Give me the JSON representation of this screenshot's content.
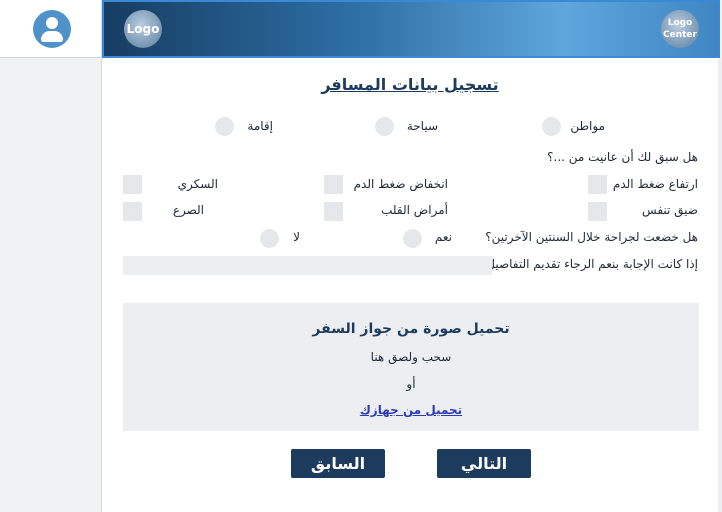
{
  "header": {
    "logo_left": "Logo",
    "logo_right_line1": "Logo",
    "logo_right_line2": "Center"
  },
  "sidebar": {
    "avatar_icon": "user-avatar-icon"
  },
  "form": {
    "title": "تسجيل بيانات المسافر",
    "traveler_type": {
      "options": [
        "مواطن",
        "سياحة",
        "إقامة"
      ]
    },
    "conditions": {
      "question": "هل سبق لك أن عانيت من ...؟",
      "items": [
        "ارتفاع ضغط الدم",
        "انخفاض ضغط الدم",
        "السكري",
        "ضيق تنفس",
        "أمراض القلب",
        "الصرع"
      ]
    },
    "surgery": {
      "question": "هل خضعت لجراحة خلال السنتين الآخرتين؟",
      "yes": "نعم",
      "no": "لا"
    },
    "details": {
      "label": "إذا كانت الإجابة بنعم الرجاء تقديم التفاصيل",
      "value": ""
    },
    "upload": {
      "title": "تحميل صورة من جواز السفر",
      "drag": "سحب ولصق هنا",
      "or": "أو",
      "link": "تحميل من جهازك"
    },
    "buttons": {
      "next": "التالي",
      "previous": "السابق"
    }
  }
}
